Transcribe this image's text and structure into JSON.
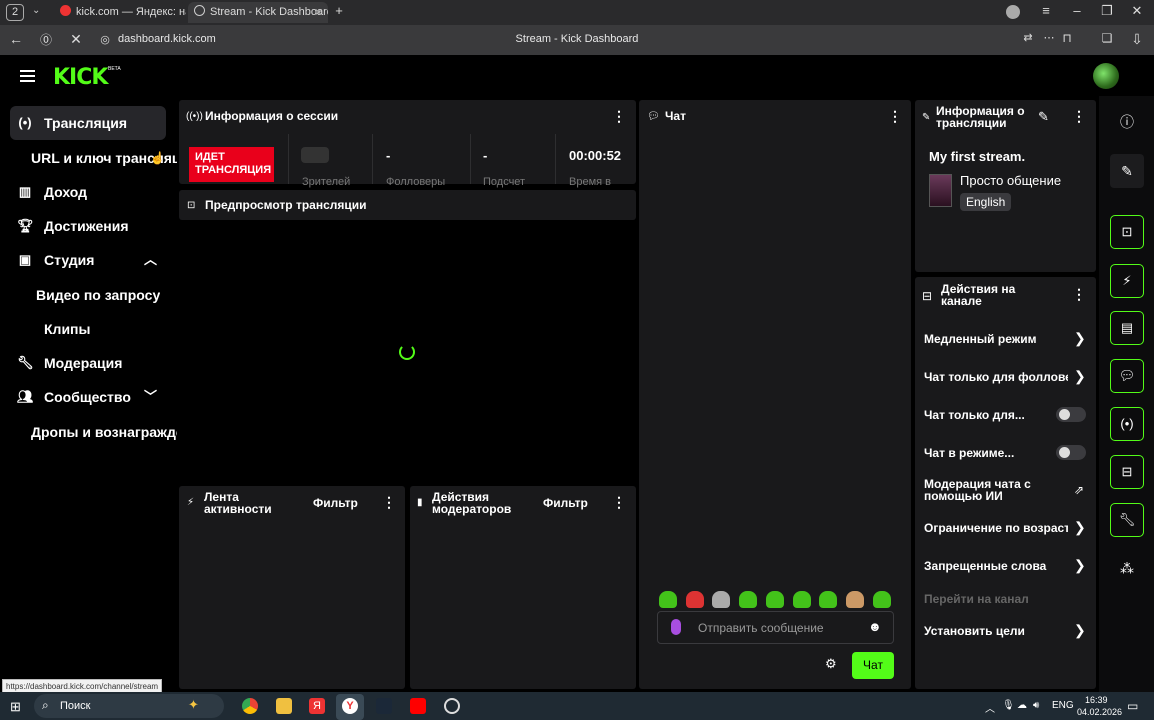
{
  "browser": {
    "tab_count": "2",
    "tabs": [
      {
        "title": "kick.com — Яндекс: нашлось"
      },
      {
        "title": "Stream - Kick Dashboard"
      }
    ],
    "url": "dashboard.kick.com",
    "page_title": "Stream - Kick Dashboard",
    "status_url": "https://dashboard.kick.com/channel/stream"
  },
  "header": {
    "logo": "KICK",
    "beta": "BETA"
  },
  "sidebar": {
    "items": [
      {
        "label": "Трансляция",
        "icon": "broadcast-icon",
        "active": true
      },
      {
        "label": "URL и ключ трансляции",
        "sub": true
      },
      {
        "label": "Доход",
        "icon": "chart-icon"
      },
      {
        "label": "Достижения",
        "icon": "trophy-icon"
      },
      {
        "label": "Студия",
        "icon": "studio-icon",
        "expand": "up"
      },
      {
        "label": "Видео по запросу",
        "sub": true
      },
      {
        "label": "Клипы",
        "sub": true
      },
      {
        "label": "Модерация",
        "icon": "wrench-icon"
      },
      {
        "label": "Сообщество",
        "icon": "community-icon",
        "expand": "down"
      },
      {
        "label": "Дропы и вознаграждения",
        "sub": true
      }
    ]
  },
  "session": {
    "title": "Информация о сессии",
    "live_badge": "ИДЕТ ТРАНСЛЯЦИЯ",
    "stats": [
      {
        "value": "",
        "label": "Зрителей"
      },
      {
        "value": "-",
        "label": "Фолловеры"
      },
      {
        "value": "-",
        "label": "Подсчет"
      },
      {
        "value": "00:00:52",
        "label": "Время в"
      }
    ]
  },
  "preview": {
    "title": "Предпросмотр трансляции"
  },
  "activity": {
    "title_line1": "Лента",
    "title_line2": "активности",
    "filter": "Фильтр"
  },
  "mod_actions": {
    "title_line1": "Действия",
    "title_line2": "модераторов",
    "filter": "Фильтр"
  },
  "chat": {
    "title": "Чат",
    "placeholder": "Отправить сообщение",
    "send": "Чат",
    "emote_count": 9
  },
  "stream_info": {
    "title_line1": "Информация о",
    "title_line2": "трансляции",
    "stream_title": "My first stream.",
    "category": "Просто общение",
    "language": "English"
  },
  "channel_actions": {
    "title_line1": "Действия на",
    "title_line2": "канале",
    "rows": [
      {
        "label": "Медленный режим",
        "control": "chevron"
      },
      {
        "label": "Чат только для фолловеров",
        "control": "chevron"
      },
      {
        "label": "Чат только для...",
        "control": "toggle"
      },
      {
        "label": "Чат в режиме...",
        "control": "toggle"
      },
      {
        "label": "Модерация чата с помощью ИИ",
        "control": "external"
      },
      {
        "label": "Ограничение по возрасту",
        "control": "chevron"
      },
      {
        "label": "Запрещенные слова",
        "control": "chevron"
      },
      {
        "label": "Перейти на канал",
        "control": "none"
      },
      {
        "label": "Установить цели",
        "control": "chevron"
      }
    ]
  },
  "taskbar": {
    "search": "Поиск",
    "lang": "ENG",
    "time": "16:39",
    "date": "04.02.2026"
  },
  "colors": {
    "accent": "#53fc18",
    "live": "#e9001b",
    "panel": "#19191b"
  }
}
